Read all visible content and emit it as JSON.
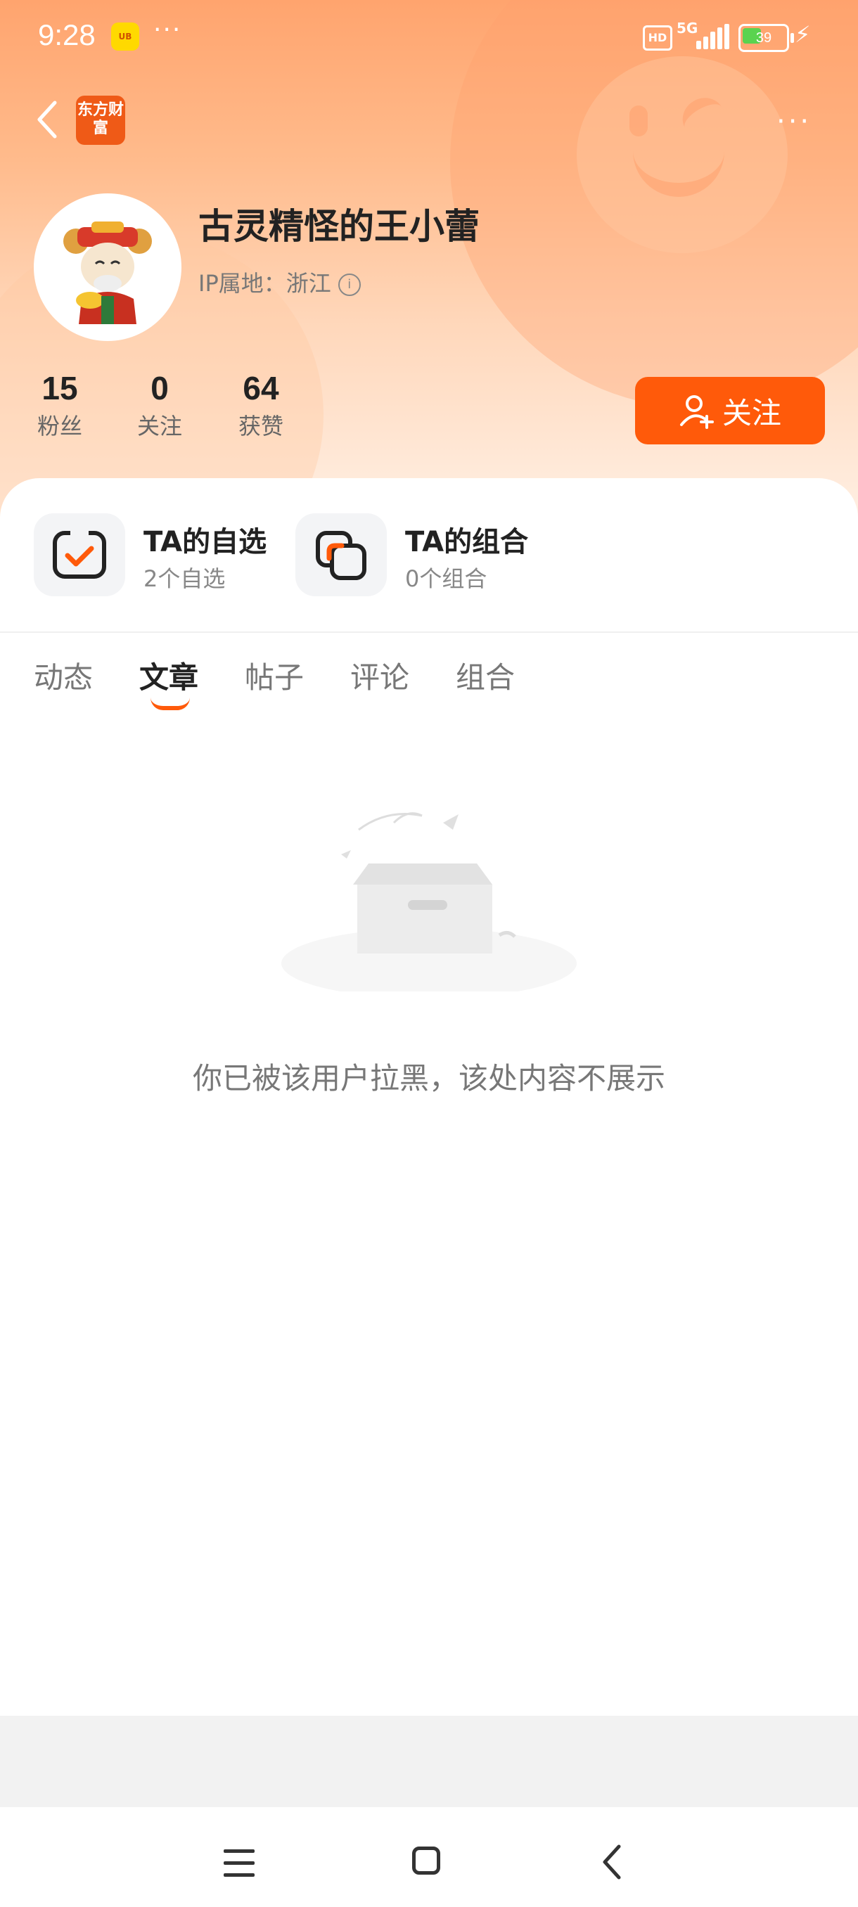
{
  "status_bar": {
    "time": "9:28",
    "mini_app_label": "UB",
    "more_dots": "···",
    "hd": "HD",
    "network": "5G",
    "battery": "39",
    "battery_level": 0.39
  },
  "header": {
    "logo_text": "东方财富",
    "more_dots": "···"
  },
  "profile": {
    "name": "古灵精怪的王小蕾",
    "ip_location": "IP属地：浙江",
    "stats": [
      {
        "value": "15",
        "label": "粉丝"
      },
      {
        "value": "0",
        "label": "关注"
      },
      {
        "value": "64",
        "label": "获赞"
      }
    ],
    "follow_label": "关注"
  },
  "shortcuts": [
    {
      "title": "TA的自选",
      "subtitle": "2个自选"
    },
    {
      "title": "TA的组合",
      "subtitle": "0个组合"
    }
  ],
  "tabs": [
    "动态",
    "文章",
    "帖子",
    "评论",
    "组合"
  ],
  "active_tab": "文章",
  "empty_state": {
    "message": "你已被该用户拉黑，该处内容不展示"
  },
  "colors": {
    "accent": "#ff5a0a",
    "hero_top": "#ffa46e",
    "hero_bottom": "#fff1e6"
  }
}
